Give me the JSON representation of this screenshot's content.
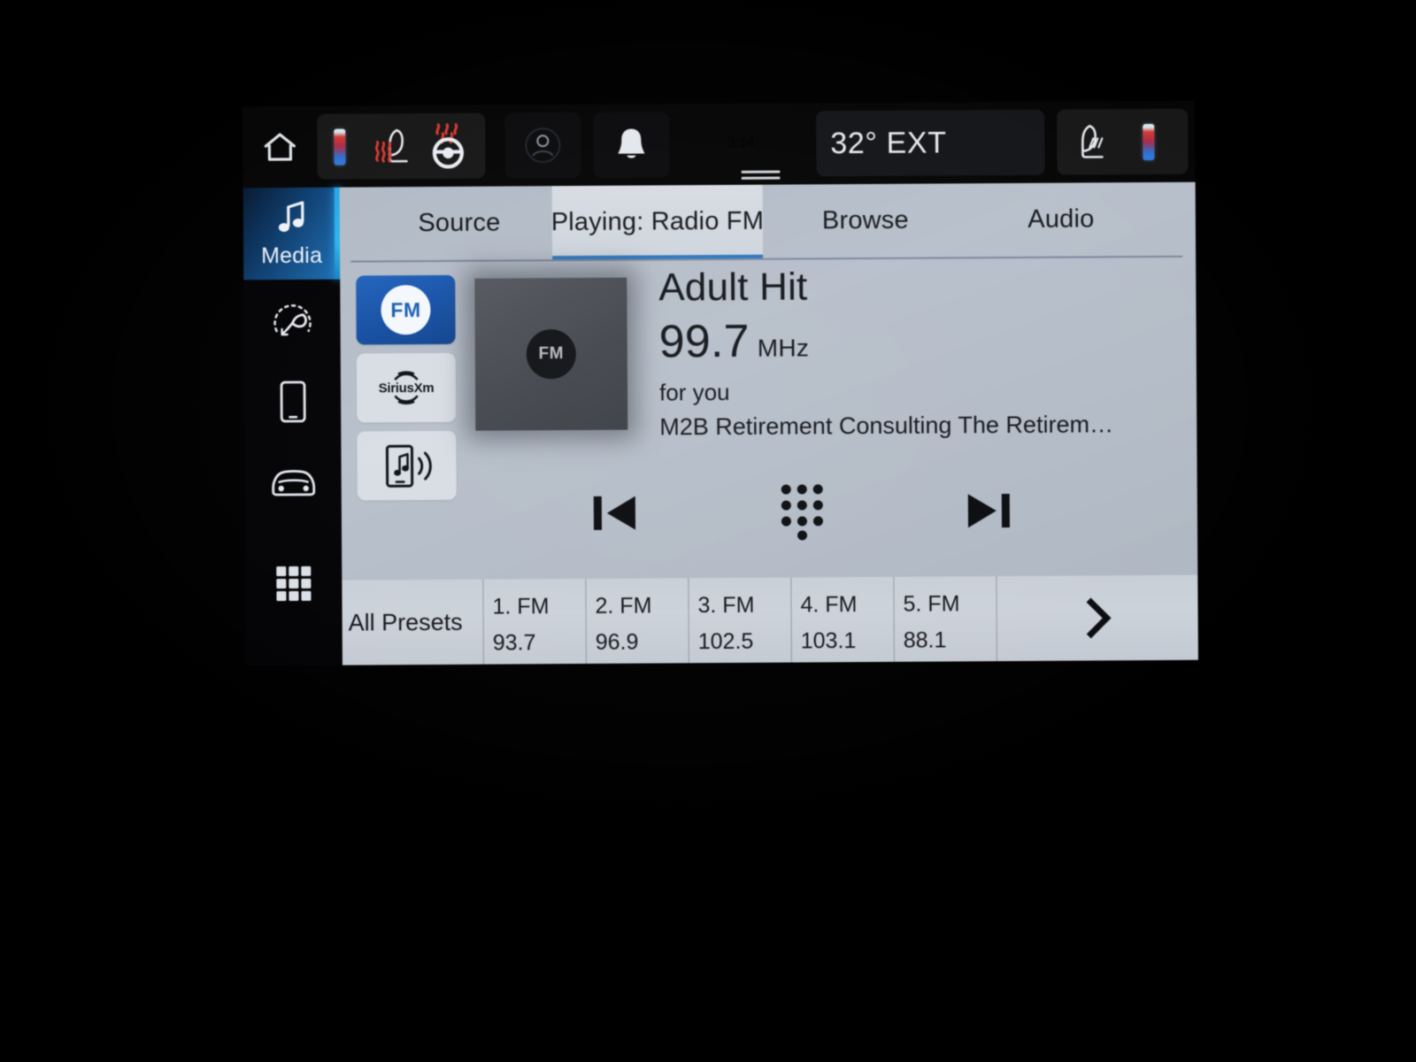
{
  "status_bar": {
    "home_icon": "home-icon",
    "left_climate": {
      "temp_bar_icon": "driver-temperature-bar-icon",
      "heated_seat_icon": "heated-seat-icon",
      "heated_steering_wheel_icon": "heated-steering-wheel-icon"
    },
    "driver_profile_icon": "driver-profile-icon",
    "notifications_icon": "bell-icon",
    "clock": "3:14",
    "exterior_temp": "32° EXT",
    "right_climate": {
      "ventilated_seat_icon": "ventilated-seat-icon",
      "temp_bar_icon": "passenger-temperature-bar-icon"
    },
    "grabber_icon": "drawer-handle-icon"
  },
  "sidebar": {
    "items": [
      {
        "label": "Media",
        "icon": "music-note-icon",
        "active": true
      },
      {
        "label": "",
        "icon": "climate-dial-icon",
        "active": false
      },
      {
        "label": "",
        "icon": "phone-icon",
        "active": false
      },
      {
        "label": "",
        "icon": "vehicle-icon",
        "active": false
      },
      {
        "label": "",
        "icon": "apps-grid-icon",
        "active": false
      }
    ]
  },
  "tabs": [
    {
      "label": "Source",
      "active": false
    },
    {
      "label": "Playing: Radio FM",
      "active": true
    },
    {
      "label": "Browse",
      "active": false
    },
    {
      "label": "Audio",
      "active": false
    }
  ],
  "sources": [
    {
      "label": "FM",
      "icon": "fm-radio-icon",
      "active": true
    },
    {
      "label": "SiriusXM",
      "icon": "siriusxm-icon",
      "active": false
    },
    {
      "label": "Bluetooth Audio",
      "icon": "phone-audio-icon",
      "active": false
    }
  ],
  "album_art": {
    "badge_label": "FM",
    "icon": "album-art-placeholder-icon"
  },
  "now_playing": {
    "station_name": "Adult Hit",
    "frequency": "99.7",
    "frequency_unit": "MHz",
    "tagline": "for you",
    "radio_text": "M2B Retirement Consulting The Retirem…"
  },
  "transport": {
    "previous_icon": "skip-previous-icon",
    "keypad_icon": "direct-tune-keypad-icon",
    "next_icon": "skip-next-icon"
  },
  "presets": {
    "all_label": "All Presets",
    "items": [
      {
        "label": "1. FM",
        "value": "93.7"
      },
      {
        "label": "2. FM",
        "value": "96.9"
      },
      {
        "label": "3. FM",
        "value": "102.5"
      },
      {
        "label": "4. FM",
        "value": "103.1"
      },
      {
        "label": "5. FM",
        "value": "88.1"
      }
    ],
    "next_page_icon": "chevron-right-icon"
  },
  "colors": {
    "accent_blue": "#1a6fb8",
    "active_tab_underline": "#2b78c4",
    "source_active": "#1551a8",
    "panel_bg": "#b4bcc7",
    "preset_bg": "#ccd2da",
    "status_bg": "#060606",
    "heat_red": "#e0392f"
  }
}
